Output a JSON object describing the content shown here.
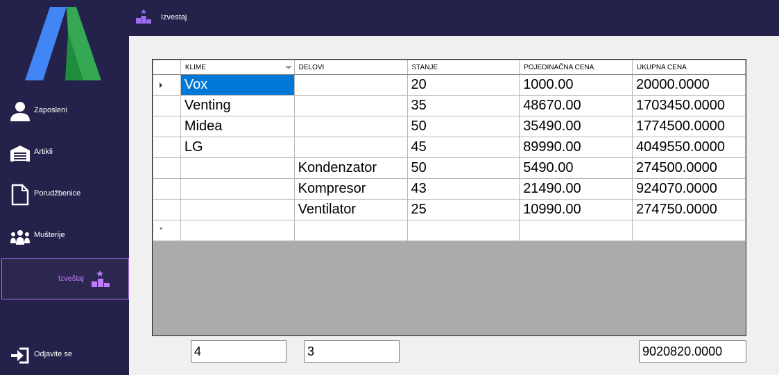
{
  "header": {
    "title": "Izvestaj",
    "icon": "podium-icon"
  },
  "sidebar": {
    "logo": "app-logo",
    "items": [
      {
        "label": "Zaposleni",
        "icon": "person-icon"
      },
      {
        "label": "Artikli",
        "icon": "warehouse-icon"
      },
      {
        "label": "Porudžbenice",
        "icon": "document-icon"
      },
      {
        "label": "Mušterije",
        "icon": "group-icon"
      },
      {
        "label": "Izveštaj",
        "icon": "podium-icon",
        "active": true
      },
      {
        "label": "Odjavite se",
        "icon": "logout-icon"
      }
    ]
  },
  "grid": {
    "columns": [
      "KLIME",
      "DELOVI",
      "STANJE",
      "POJEDINAČNA CENA",
      "UKUPNA CENA"
    ],
    "rows": [
      [
        "Vox",
        "",
        "20",
        "1000.00",
        "20000.0000"
      ],
      [
        "Venting",
        "",
        "35",
        "48670.00",
        "1703450.0000"
      ],
      [
        "Midea",
        "",
        "50",
        "35490.00",
        "1774500.0000"
      ],
      [
        "LG",
        "",
        "45",
        "89990.00",
        "4049550.0000"
      ],
      [
        "",
        "Kondenzator",
        "50",
        "5490.00",
        "274500.0000"
      ],
      [
        "",
        "Kompresor",
        "43",
        "21490.00",
        "924070.0000"
      ],
      [
        "",
        "Ventilator",
        "25",
        "10990.00",
        "274750.0000"
      ]
    ],
    "new_row_marker": "*"
  },
  "totals": {
    "klime_count": "4",
    "delovi_count": "3",
    "total_sum": "9020820.0000"
  },
  "colors": {
    "sidebar_bg": "#24214a",
    "accent": "#b46cf6",
    "selection": "#0078d7",
    "grid_empty": "#ababab"
  }
}
